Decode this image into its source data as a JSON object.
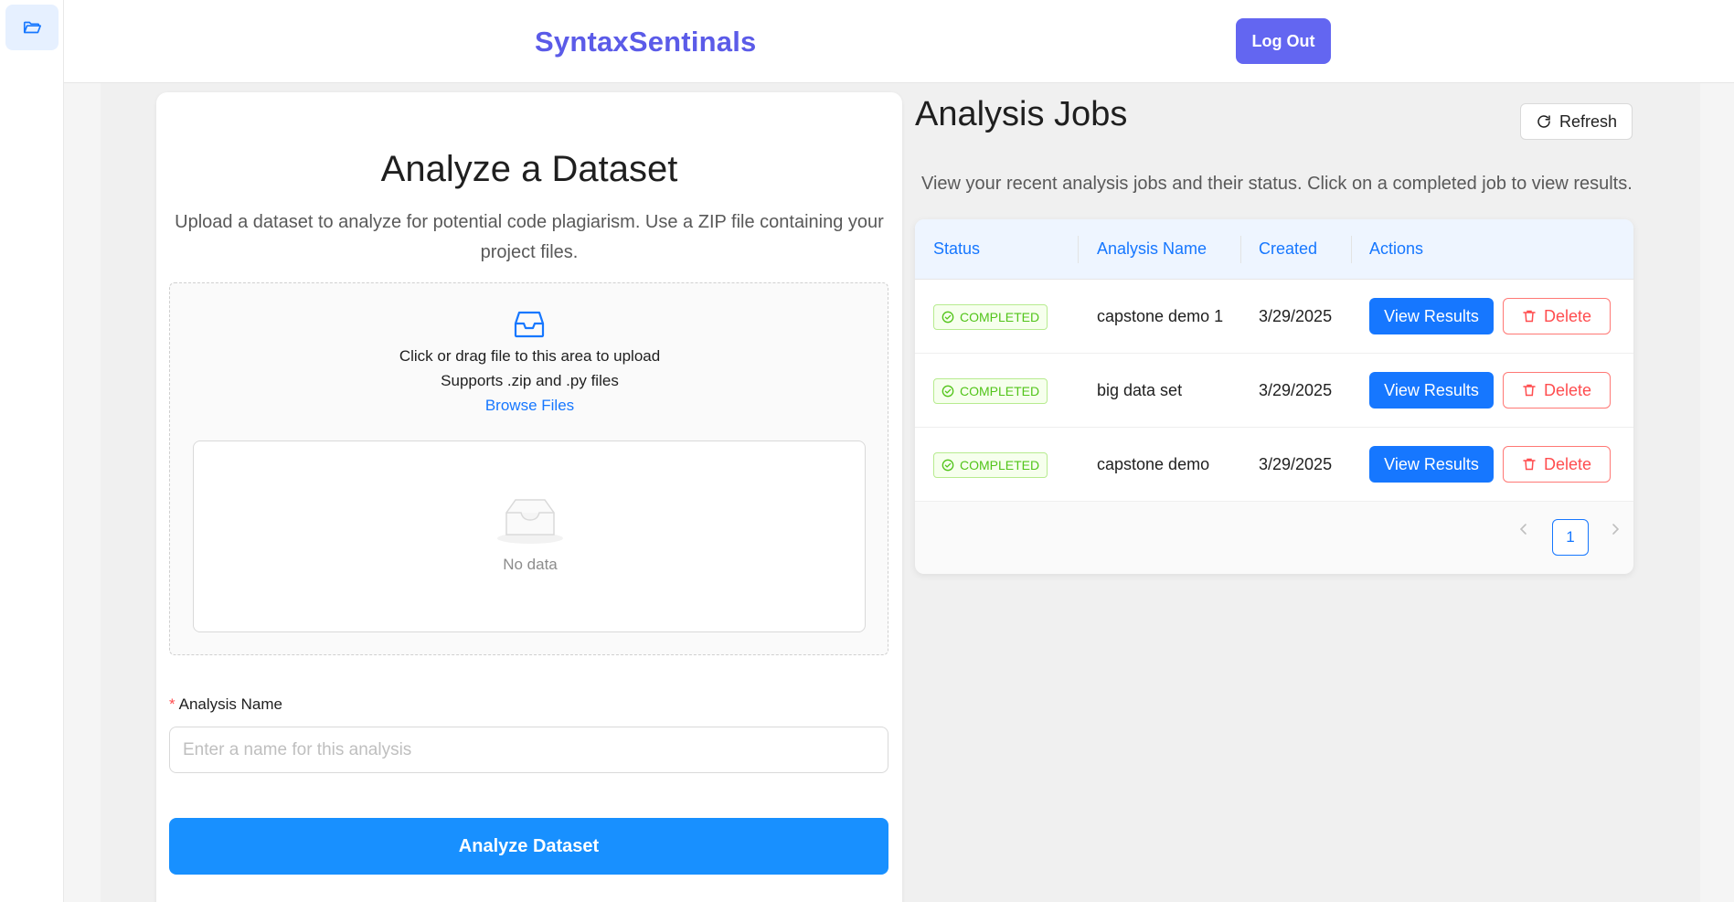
{
  "sidebar": {
    "icon": "folder-open-icon"
  },
  "header": {
    "brand": "SyntaxSentinals",
    "logout_label": "Log Out"
  },
  "upload_card": {
    "title": "Analyze a Dataset",
    "description": "Upload a dataset to analyze for potential code plagiarism. Use a ZIP file containing your project files.",
    "dropzone": {
      "icon": "inbox-icon",
      "primary_text": "Click or drag file to this area to upload",
      "secondary_text": "Supports .zip and .py files",
      "browse_label": "Browse Files"
    },
    "file_list": {
      "empty_icon": "empty-box-icon",
      "empty_text": "No data"
    },
    "analysis_name": {
      "required_mark": "*",
      "label": "Analysis Name",
      "placeholder": "Enter a name for this analysis",
      "value": ""
    },
    "submit_label": "Analyze Dataset"
  },
  "jobs": {
    "title": "Analysis Jobs",
    "refresh_label": "Refresh",
    "description": "View your recent analysis jobs and their status. Click on a completed job to view results.",
    "columns": [
      "Status",
      "Analysis Name",
      "Created",
      "Actions"
    ],
    "rows": [
      {
        "status": "COMPLETED",
        "name": "capstone demo 1",
        "created": "3/29/2025",
        "view_label": "View Results",
        "delete_label": "Delete"
      },
      {
        "status": "COMPLETED",
        "name": "big data set",
        "created": "3/29/2025",
        "view_label": "View Results",
        "delete_label": "Delete"
      },
      {
        "status": "COMPLETED",
        "name": "capstone demo",
        "created": "3/29/2025",
        "view_label": "View Results",
        "delete_label": "Delete"
      }
    ],
    "pagination": {
      "current_page": "1",
      "prev_icon": "chevron-left-icon",
      "next_icon": "chevron-right-icon"
    }
  },
  "colors": {
    "brand": "#5b5be8",
    "logout": "#6366f1",
    "primary": "#1677ff",
    "success": "#52c41a",
    "danger": "#ff4d4f"
  }
}
